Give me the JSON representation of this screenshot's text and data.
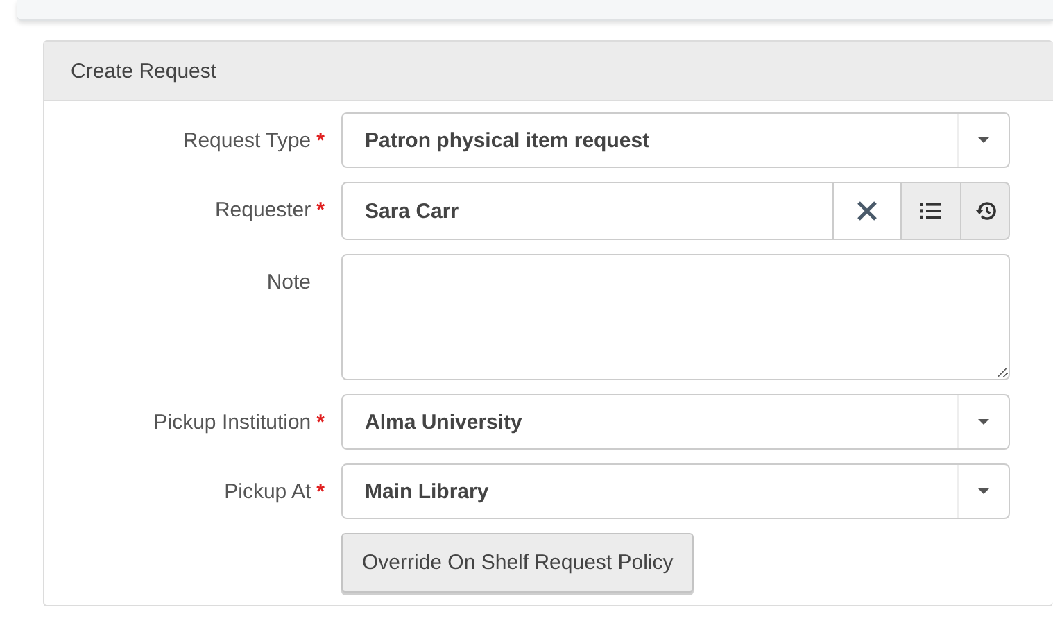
{
  "panel": {
    "title": "Create Request"
  },
  "fields": [
    {
      "label": "Request Type",
      "required_mark": "*",
      "kind": "select",
      "value": "Patron physical item request"
    },
    {
      "label": "Requester",
      "required_mark": "*",
      "kind": "lookup",
      "value": "Sara Carr"
    },
    {
      "label": "Note",
      "kind": "textarea"
    },
    {
      "label": "Pickup Institution",
      "required_mark": "*",
      "kind": "select",
      "value": "Alma University"
    },
    {
      "label": "Pickup At",
      "required_mark": "*",
      "kind": "select",
      "value": "Main Library"
    }
  ],
  "button": "Override On Shelf Request Policy"
}
